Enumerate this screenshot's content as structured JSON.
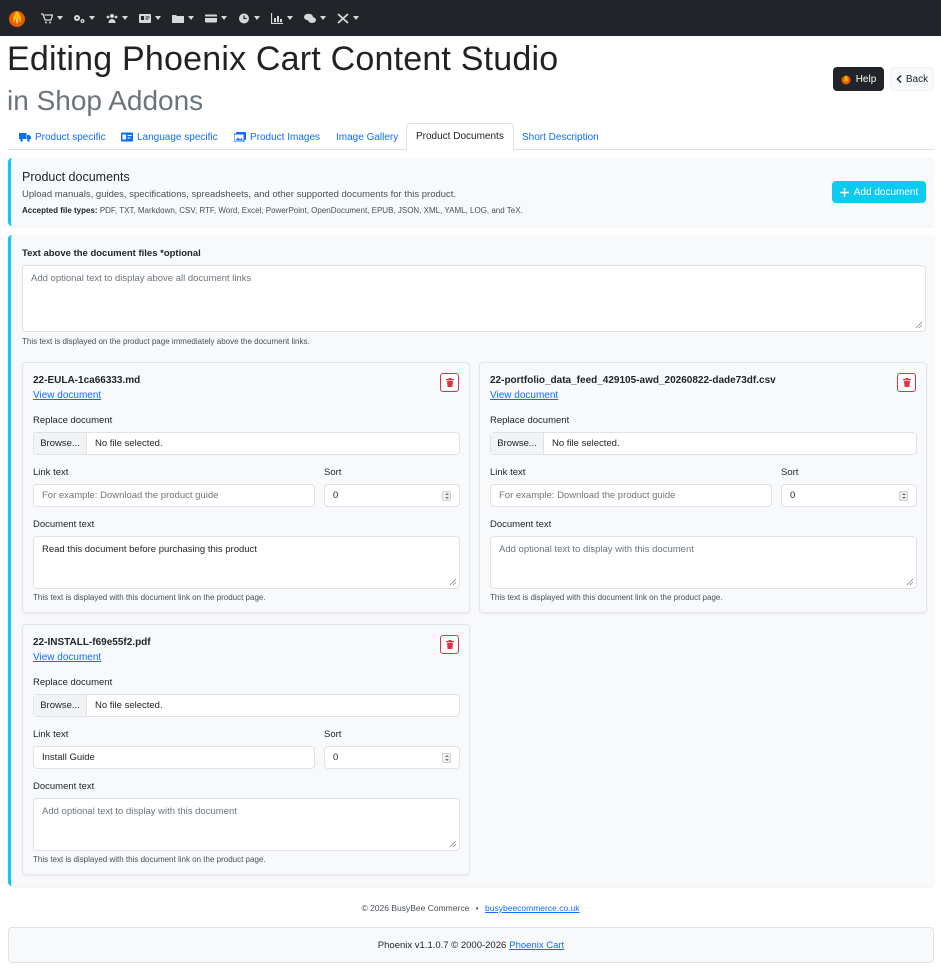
{
  "nav": {
    "items": [
      {
        "icon": "cart-icon"
      },
      {
        "icon": "gears-icon"
      },
      {
        "icon": "users-icon"
      },
      {
        "icon": "id-card-icon"
      },
      {
        "icon": "folder-icon"
      },
      {
        "icon": "credit-card-icon"
      },
      {
        "icon": "clock-icon"
      },
      {
        "icon": "chart-icon"
      },
      {
        "icon": "chat-icon"
      },
      {
        "icon": "tools-icon"
      }
    ]
  },
  "header": {
    "title": "Editing Phoenix Cart Content Studio",
    "subtitle": "in Shop Addons",
    "help_label": "Help",
    "back_label": "Back"
  },
  "tabs": [
    {
      "label": "Product specific",
      "icon": "truck-icon",
      "active": false
    },
    {
      "label": "Language specific",
      "icon": "language-icon",
      "active": false
    },
    {
      "label": "Product Images",
      "icon": "images-icon",
      "active": false
    },
    {
      "label": "Image Gallery",
      "icon": "",
      "active": false
    },
    {
      "label": "Product Documents",
      "icon": "",
      "active": true
    },
    {
      "label": "Short Description",
      "icon": "",
      "active": false
    }
  ],
  "info": {
    "title": "Product documents",
    "subtitle": "Upload manuals, guides, specifications, spreadsheets, and other supported documents for this product.",
    "types_label": "Accepted file types:",
    "types": "PDF, TXT, Markdown, CSV, RTF, Word, Excel, PowerPoint, OpenDocument, EPUB, JSON, XML, YAML, LOG, and TeX.",
    "add_label": "Add document"
  },
  "above": {
    "label": "Text above the document files *optional",
    "placeholder": "Add optional text to display above all document links",
    "help": "This text is displayed on the product page immediately above the document links."
  },
  "doc_labels": {
    "view": "View document",
    "replace": "Replace document",
    "browse": "Browse...",
    "no_file": "No file selected.",
    "link_text": "Link text",
    "sort": "Sort",
    "doc_text": "Document text",
    "help": "This text is displayed with this document link on the product page."
  },
  "documents": [
    {
      "name": "22-EULA-1ca66333.md",
      "link_text": "",
      "link_placeholder": "For example: Download the product guide",
      "sort": "0",
      "doc_text": "Read this document before purchasing this product",
      "doc_placeholder": "Add optional text to display with this document"
    },
    {
      "name": "22-portfolio_data_feed_429105-awd_20260822-dade73df.csv",
      "link_text": "",
      "link_placeholder": "For example: Download the product guide",
      "sort": "0",
      "doc_text": "",
      "doc_placeholder": "Add optional text to display with this document"
    },
    {
      "name": "22-INSTALL-f69e55f2.pdf",
      "link_text": "Install Guide",
      "link_placeholder": "For example: Download the product guide",
      "sort": "0",
      "doc_text": "",
      "doc_placeholder": "Add optional text to display with this document"
    }
  ],
  "footer": {
    "copy": "© 2026 BusyBee Commerce",
    "sep": "•",
    "link": "busybeecommerce.co.uk",
    "version": "Phoenix v1.1.0.7 © 2000-2026",
    "version_link": "Phoenix Cart"
  },
  "colors": {
    "accent": "#0dcaf0",
    "link": "#0d6efd",
    "danger": "#dc3545",
    "navbar": "#212529"
  }
}
